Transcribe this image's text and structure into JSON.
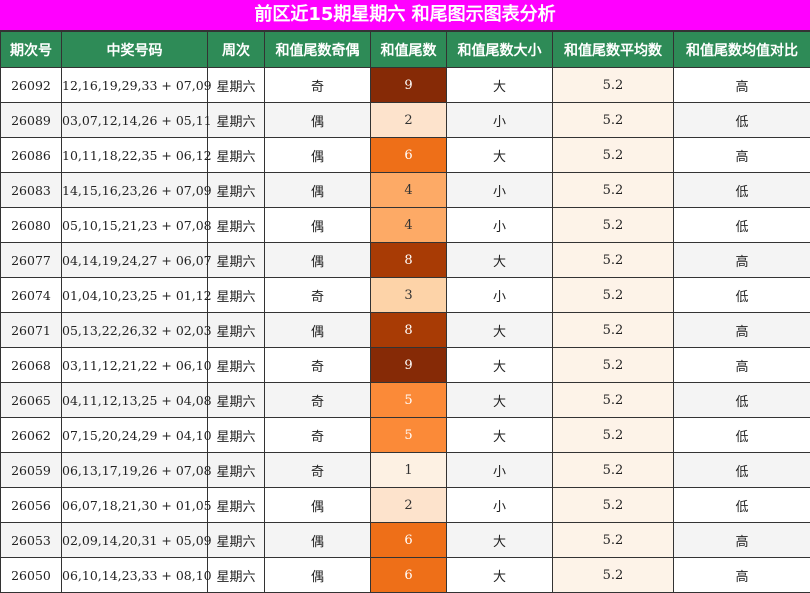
{
  "title": "前区近15期星期六 和尾图示图表分析",
  "columns": [
    "期次号",
    "中奖号码",
    "周次",
    "和值尾数奇偶",
    "和值尾数",
    "和值尾数大小",
    "和值尾数平均数",
    "和值尾数均值对比"
  ],
  "rows": [
    {
      "issue": "26092",
      "numbers": "12,16,19,29,33 + 07,09",
      "weekday": "星期六",
      "parity": "奇",
      "tail": "9",
      "size": "大",
      "avg": "5.2",
      "compare": "高"
    },
    {
      "issue": "26089",
      "numbers": "03,07,12,14,26 + 05,11",
      "weekday": "星期六",
      "parity": "偶",
      "tail": "2",
      "size": "小",
      "avg": "5.2",
      "compare": "低"
    },
    {
      "issue": "26086",
      "numbers": "10,11,18,22,35 + 06,12",
      "weekday": "星期六",
      "parity": "偶",
      "tail": "6",
      "size": "大",
      "avg": "5.2",
      "compare": "高"
    },
    {
      "issue": "26083",
      "numbers": "14,15,16,23,26 + 07,09",
      "weekday": "星期六",
      "parity": "偶",
      "tail": "4",
      "size": "小",
      "avg": "5.2",
      "compare": "低"
    },
    {
      "issue": "26080",
      "numbers": "05,10,15,21,23 + 07,08",
      "weekday": "星期六",
      "parity": "偶",
      "tail": "4",
      "size": "小",
      "avg": "5.2",
      "compare": "低"
    },
    {
      "issue": "26077",
      "numbers": "04,14,19,24,27 + 06,07",
      "weekday": "星期六",
      "parity": "偶",
      "tail": "8",
      "size": "大",
      "avg": "5.2",
      "compare": "高"
    },
    {
      "issue": "26074",
      "numbers": "01,04,10,23,25 + 01,12",
      "weekday": "星期六",
      "parity": "奇",
      "tail": "3",
      "size": "小",
      "avg": "5.2",
      "compare": "低"
    },
    {
      "issue": "26071",
      "numbers": "05,13,22,26,32 + 02,03",
      "weekday": "星期六",
      "parity": "偶",
      "tail": "8",
      "size": "大",
      "avg": "5.2",
      "compare": "高"
    },
    {
      "issue": "26068",
      "numbers": "03,11,12,21,22 + 06,10",
      "weekday": "星期六",
      "parity": "奇",
      "tail": "9",
      "size": "大",
      "avg": "5.2",
      "compare": "高"
    },
    {
      "issue": "26065",
      "numbers": "04,11,12,13,25 + 04,08",
      "weekday": "星期六",
      "parity": "奇",
      "tail": "5",
      "size": "大",
      "avg": "5.2",
      "compare": "低"
    },
    {
      "issue": "26062",
      "numbers": "07,15,20,24,29 + 04,10",
      "weekday": "星期六",
      "parity": "奇",
      "tail": "5",
      "size": "大",
      "avg": "5.2",
      "compare": "低"
    },
    {
      "issue": "26059",
      "numbers": "06,13,17,19,26 + 07,08",
      "weekday": "星期六",
      "parity": "奇",
      "tail": "1",
      "size": "小",
      "avg": "5.2",
      "compare": "低"
    },
    {
      "issue": "26056",
      "numbers": "06,07,18,21,30 + 01,05",
      "weekday": "星期六",
      "parity": "偶",
      "tail": "2",
      "size": "小",
      "avg": "5.2",
      "compare": "低"
    },
    {
      "issue": "26053",
      "numbers": "02,09,14,20,31 + 05,09",
      "weekday": "星期六",
      "parity": "偶",
      "tail": "6",
      "size": "大",
      "avg": "5.2",
      "compare": "高"
    },
    {
      "issue": "26050",
      "numbers": "06,10,14,23,33 + 08,10",
      "weekday": "星期六",
      "parity": "偶",
      "tail": "6",
      "size": "大",
      "avg": "5.2",
      "compare": "高"
    }
  ],
  "tail_colors": {
    "1": {
      "bg": "#fdf1e3",
      "fg": "#333333"
    },
    "2": {
      "bg": "#fde3cc",
      "fg": "#333333"
    },
    "3": {
      "bg": "#fdd3a8",
      "fg": "#333333"
    },
    "4": {
      "bg": "#fdaa66",
      "fg": "#333333"
    },
    "5": {
      "bg": "#fb8a38",
      "fg": "#ffffff"
    },
    "6": {
      "bg": "#ee6f18",
      "fg": "#ffffff"
    },
    "8": {
      "bg": "#a83b05",
      "fg": "#ffffff"
    },
    "9": {
      "bg": "#862a06",
      "fg": "#ffffff"
    }
  }
}
